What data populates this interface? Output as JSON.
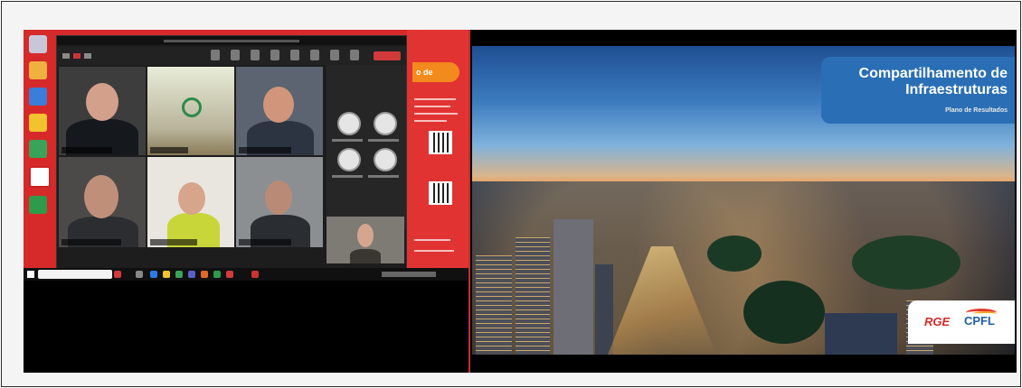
{
  "slide": {
    "title": "Compartilhamento de Infraestruturas",
    "subtitle": "Plano de Resultados",
    "logos": {
      "rge": "RGE",
      "cpfl": "CPFL"
    }
  },
  "meeting": {
    "participants": [
      {
        "id": "p1"
      },
      {
        "id": "p2"
      },
      {
        "id": "p3"
      },
      {
        "id": "p4"
      },
      {
        "id": "p5"
      },
      {
        "id": "p6"
      },
      {
        "id": "p7"
      }
    ],
    "leave_label": ""
  },
  "taskbar": {
    "search_placeholder": ""
  },
  "promo": {
    "badge": "o de"
  },
  "colors": {
    "zoom_bg": "#1d1d1d",
    "desktop_red": "#d62a2a",
    "slide_blue": "#2a6fb5",
    "rge_red": "#d32a2a",
    "cpfl_blue": "#1f5fa8"
  },
  "icons": [
    "start-icon",
    "search-icon",
    "mic-icon",
    "video-icon",
    "share-icon",
    "participants-icon",
    "chat-icon",
    "reactions-icon",
    "leave-icon"
  ]
}
